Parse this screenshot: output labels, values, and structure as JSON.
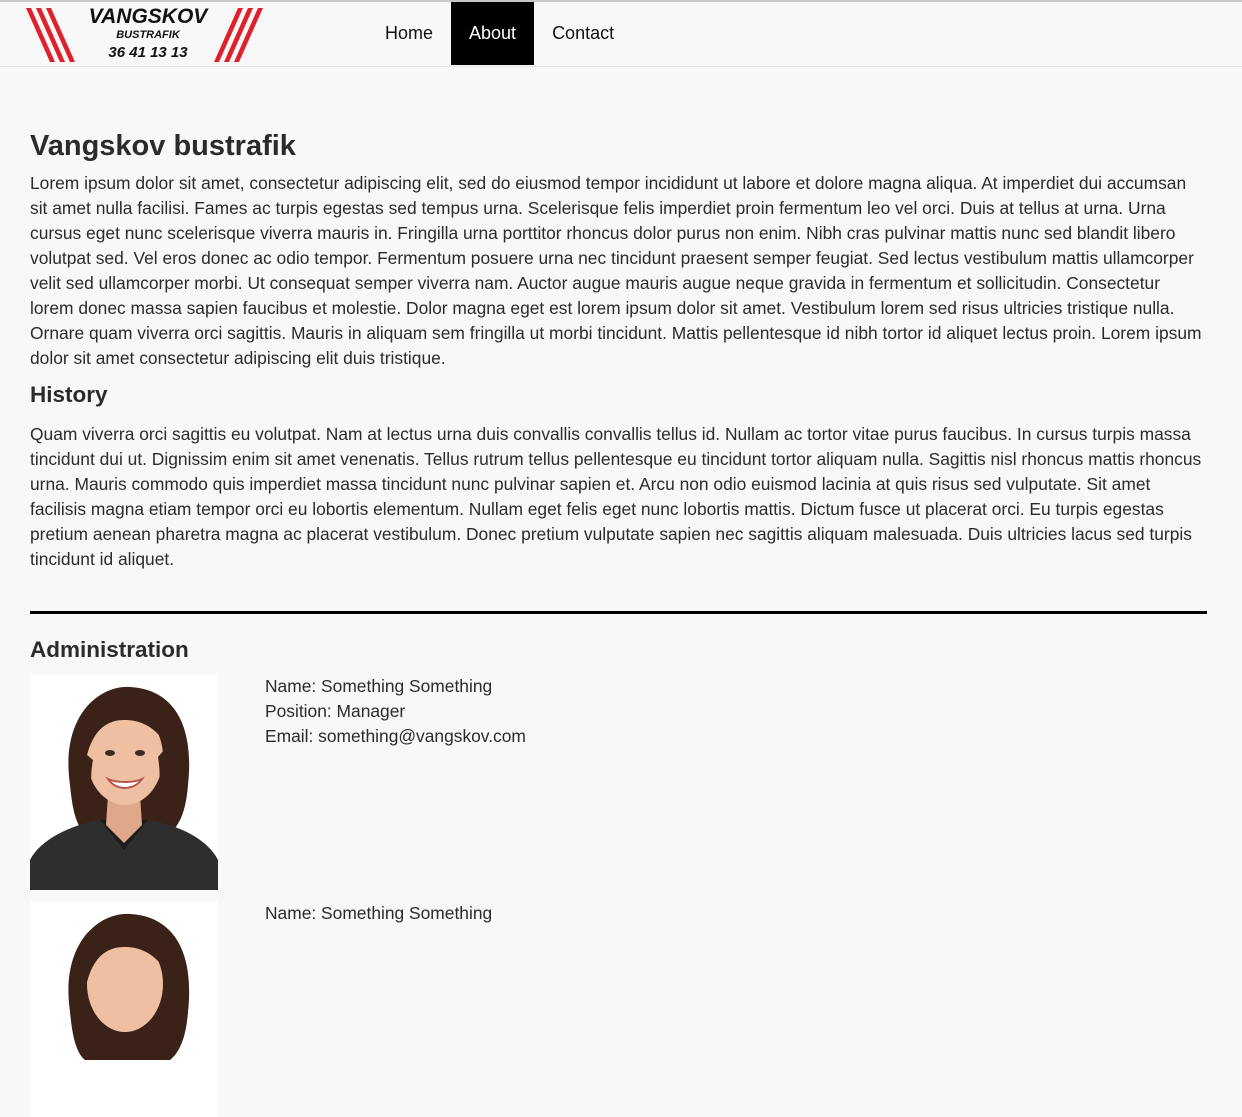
{
  "logo": {
    "name": "VANGSKOV",
    "subtitle": "BUSTRAFIK",
    "phone": "36 41 13 13",
    "accent": "#e0202b"
  },
  "nav": {
    "items": [
      {
        "label": "Home",
        "active": false
      },
      {
        "label": "About",
        "active": true
      },
      {
        "label": "Contact",
        "active": false
      }
    ]
  },
  "main": {
    "title": "Vangskov bustrafik",
    "intro": "Lorem ipsum dolor sit amet, consectetur adipiscing elit, sed do eiusmod tempor incididunt ut labore et dolore magna aliqua. At imperdiet dui accumsan sit amet nulla facilisi. Fames ac turpis egestas sed tempus urna. Scelerisque felis imperdiet proin fermentum leo vel orci. Duis at tellus at urna. Urna cursus eget nunc scelerisque viverra mauris in. Fringilla urna porttitor rhoncus dolor purus non enim. Nibh cras pulvinar mattis nunc sed blandit libero volutpat sed. Vel eros donec ac odio tempor. Fermentum posuere urna nec tincidunt praesent semper feugiat. Sed lectus vestibulum mattis ullamcorper velit sed ullamcorper morbi. Ut consequat semper viverra nam. Auctor augue mauris augue neque gravida in fermentum et sollicitudin. Consectetur lorem donec massa sapien faucibus et molestie. Dolor magna eget est lorem ipsum dolor sit amet. Vestibulum lorem sed risus ultricies tristique nulla. Ornare quam viverra orci sagittis. Mauris in aliquam sem fringilla ut morbi tincidunt. Mattis pellentesque id nibh tortor id aliquet lectus proin. Lorem ipsum dolor sit amet consectetur adipiscing elit duis tristique.",
    "history_title": "History",
    "history_text": "Quam viverra orci sagittis eu volutpat. Nam at lectus urna duis convallis convallis tellus id. Nullam ac tortor vitae purus faucibus. In cursus turpis massa tincidunt dui ut. Dignissim enim sit amet venenatis. Tellus rutrum tellus pellentesque eu tincidunt tortor aliquam nulla. Sagittis nisl rhoncus mattis rhoncus urna. Mauris commodo quis imperdiet massa tincidunt nunc pulvinar sapien et. Arcu non odio euismod lacinia at quis risus sed vulputate. Sit amet facilisis magna etiam tempor orci eu lobortis elementum. Nullam eget felis eget nunc lobortis mattis. Dictum fusce ut placerat orci. Eu turpis egestas pretium aenean pharetra magna ac placerat vestibulum. Donec pretium vulputate sapien nec sagittis aliquam malesuada. Duis ultricies lacus sed turpis tincidunt id aliquet."
  },
  "administration": {
    "title": "Administration",
    "people": [
      {
        "name_line": "Name: Something Something",
        "position_line": "Position: Manager",
        "email_line": "Email: something@vangskov.com"
      },
      {
        "name_line": "Name: Something Something",
        "position_line": "",
        "email_line": ""
      }
    ]
  }
}
